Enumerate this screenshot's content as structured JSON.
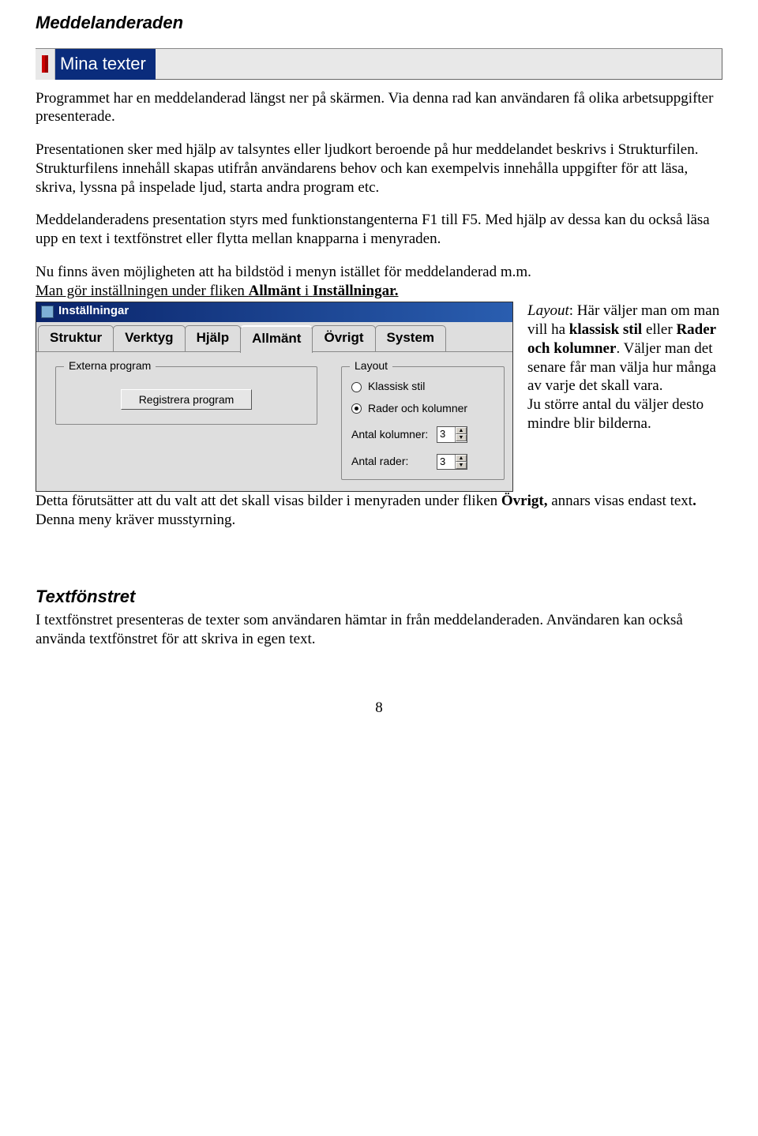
{
  "heading1": "Meddelanderaden",
  "mina_texter_label": "Mina texter",
  "para1": "Programmet har en meddelanderad längst ner på skärmen. Via denna rad kan användaren få olika arbetsuppgifter presenterade.",
  "para2": "Presentationen sker med hjälp av talsyntes eller ljudkort beroende på hur meddelandet beskrivs i Strukturfilen. Strukturfilens innehåll skapas utifrån användarens behov och kan exempelvis innehålla uppgifter för att läsa, skriva, lyssna på inspelade ljud, starta andra program etc.",
  "para3": "Meddelanderadens presentation styrs med funktionstangenterna F1 till F5. Med hjälp av dessa kan du också läsa upp en text i textfönstret eller flytta mellan knapparna i menyraden.",
  "para4_part1": "Nu finns även möjligheten att ha bildstöd i menyn istället för meddelanderad m.m.",
  "para4_part2_pre": "Man gör inställningen under fliken ",
  "para4_part2_bold1": "Allmänt",
  "para4_part2_mid": " i ",
  "para4_part2_bold2": "Inställningar.",
  "settings": {
    "title": "Inställningar",
    "tabs": {
      "struktur": "Struktur",
      "verktyg": "Verktyg",
      "hjalp": "Hjälp",
      "allmant": "Allmänt",
      "ovrigt": "Övrigt",
      "system": "System"
    },
    "left": {
      "legend": "Externa program",
      "button": "Registrera program"
    },
    "right": {
      "legend": "Layout",
      "radio1": "Klassisk stil",
      "radio2": "Rader och kolumner",
      "kolumner_label": "Antal kolumner:",
      "kolumner_val": "3",
      "rader_label": "Antal rader:",
      "rader_val": "3"
    }
  },
  "side": {
    "layout_label": "Layout",
    "line1": ": Här väljer man om man vill ha ",
    "bold1": "klassisk stil",
    "line1b": " eller ",
    "bold2": "Rader och kolumner",
    "line2": ". Väljer man det senare får man välja hur många av varje det skall vara.",
    "line3": "Ju större antal du väljer desto mindre blir bilderna."
  },
  "cont_pre": "Detta förutsätter att du valt att det skall visas bilder i menyraden under fliken ",
  "cont_bold": "Övrigt,",
  "cont_post": " annars visas endast text",
  "cont_bold2": ".",
  "cont_tail": " Denna meny kräver musstyrning.",
  "heading2": "Textfönstret",
  "tf_para": "I textfönstret presenteras de texter som användaren hämtar in från meddelanderaden. Användaren kan också använda textfönstret för att skriva in egen text.",
  "page_number": "8"
}
